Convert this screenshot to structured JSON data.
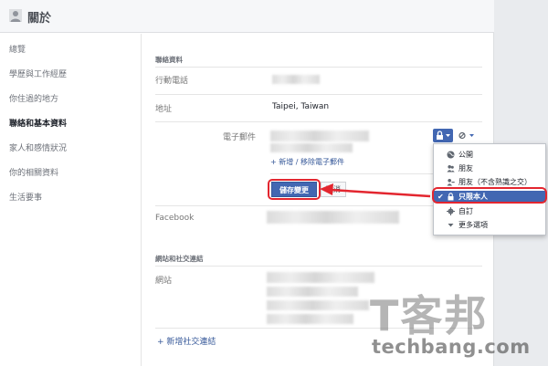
{
  "header": {
    "title": "關於"
  },
  "sidebar": {
    "items": [
      {
        "label": "總覽"
      },
      {
        "label": "學歷與工作經歷"
      },
      {
        "label": "你住過的地方"
      },
      {
        "label": "聯絡和基本資料"
      },
      {
        "label": "家人和感情狀況"
      },
      {
        "label": "你的相關資料"
      },
      {
        "label": "生活要事"
      }
    ]
  },
  "contact": {
    "section_title": "聯絡資料",
    "phone_label": "行動電話",
    "address_label": "地址",
    "address_value": "Taipei, Taiwan",
    "email_label": "電子郵件",
    "add_remove_email": "+ 新增 / 移除電子郵件",
    "save_label": "儲存變更",
    "cancel_label": "取消",
    "facebook_label": "Facebook"
  },
  "websites": {
    "section_title": "網站和社交連結",
    "site_label": "網站",
    "add_social_link": "+ 新增社交連結"
  },
  "privacy_menu": {
    "items": [
      {
        "label": "公開",
        "icon": "globe-icon"
      },
      {
        "label": "朋友",
        "icon": "friends-icon"
      },
      {
        "label": "朋友（不含熟識之交）",
        "icon": "friends-except-icon"
      },
      {
        "label": "只限本人",
        "icon": "lock-icon",
        "selected": true
      },
      {
        "label": "自訂",
        "icon": "gear-icon"
      },
      {
        "label": "更多選項",
        "icon": "caret-down-icon"
      }
    ]
  },
  "watermark": {
    "big": "T客邦",
    "small": "techbang.com"
  },
  "colors": {
    "accent": "#4267b2",
    "highlight": "#e3262f",
    "background": "#e9ebee"
  }
}
